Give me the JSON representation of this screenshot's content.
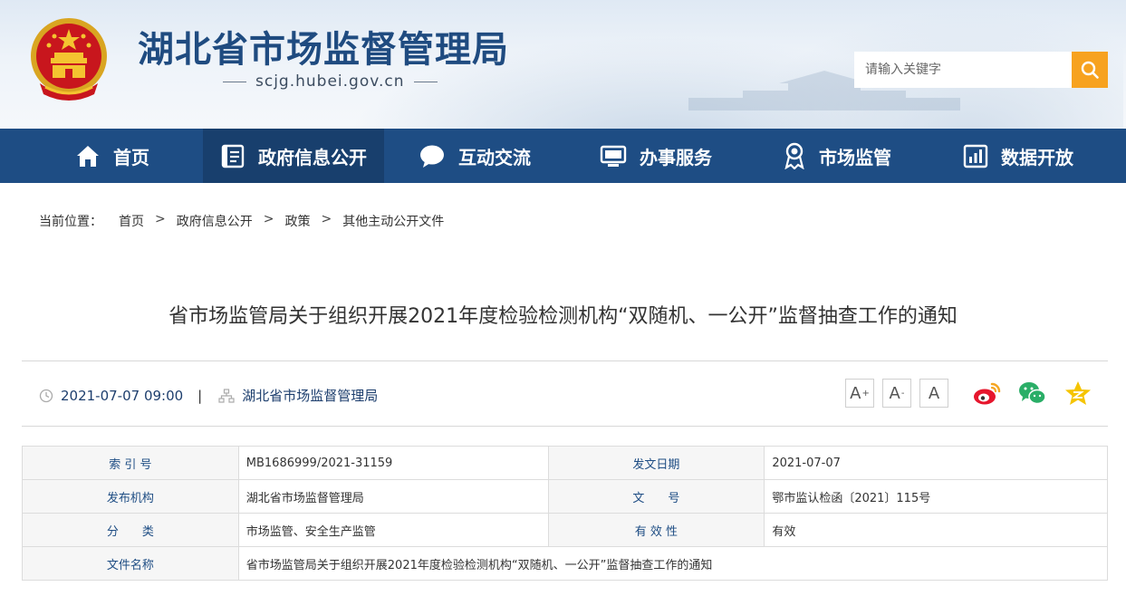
{
  "header": {
    "site_title": "湖北省市场监督管理局",
    "site_url": "scjg.hubei.gov.cn",
    "search_placeholder": "请输入关键字"
  },
  "nav": {
    "items": [
      {
        "label": "首页",
        "icon": "home-icon"
      },
      {
        "label": "政府信息公开",
        "icon": "document-list-icon"
      },
      {
        "label": "互动交流",
        "icon": "chat-bubble-icon"
      },
      {
        "label": "办事服务",
        "icon": "monitor-icon"
      },
      {
        "label": "市场监管",
        "icon": "badge-icon"
      },
      {
        "label": "数据开放",
        "icon": "bar-chart-icon"
      }
    ],
    "active_index": 1
  },
  "breadcrumb": {
    "label": "当前位置：",
    "items": [
      "首页",
      "政府信息公开",
      "政策",
      "其他主动公开文件"
    ],
    "separator": ">"
  },
  "article": {
    "title": "省市场监管局关于组织开展2021年度检验检测机构“双随机、一公开”监督抽查工作的通知",
    "datetime": "2021-07-07 09:00",
    "meta_separator": "|",
    "publisher": "湖北省市场监督管理局"
  },
  "tools": {
    "font_increase": "A",
    "font_decrease": "A",
    "font_reset": "A",
    "increase_mark": "+",
    "decrease_mark": "-"
  },
  "info_table": {
    "rows": [
      [
        "索 引 号",
        "MB1686999/2021-31159",
        "发文日期",
        "2021-07-07"
      ],
      [
        "发布机构",
        "湖北省市场监督管理局",
        "文　　号",
        "鄂市监认检函〔2021〕115号"
      ],
      [
        "分　　类",
        "市场监管、安全生产监管",
        "有 效 性",
        "有效"
      ]
    ],
    "title_row": [
      "文件名称",
      "省市场监管局关于组织开展2021年度检验检测机构“双随机、一公开”监督抽查工作的通知"
    ]
  },
  "colors": {
    "nav_bg": "#1e4d84",
    "nav_active": "#183f6d",
    "search_button": "#f7a21f",
    "title_blue": "#1f4b80"
  }
}
